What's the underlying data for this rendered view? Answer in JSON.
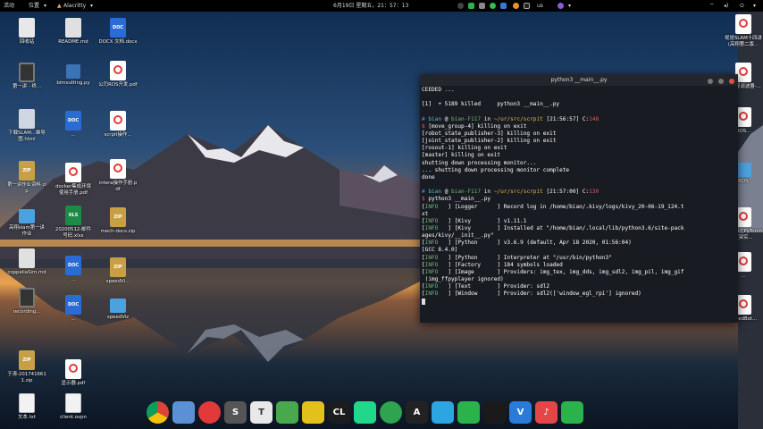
{
  "top_panel": {
    "activities": "活动",
    "places": "位置",
    "app_name": "Alacritty",
    "clock": "6月19日 星期五，21：57：13",
    "tray_text": "us"
  },
  "desktop_icons": [
    {
      "label": "回收站",
      "type": "trash"
    },
    {
      "label": "README.md",
      "type": "md"
    },
    {
      "label": "DOCX 文档.docx",
      "type": "doc"
    },
    {
      "label": "视觉SLAM十四讲(高翔第二版...",
      "type": "pdf"
    },
    {
      "label": "第一讲 - 终...",
      "type": "video"
    },
    {
      "label": "bimsutting.py",
      "type": "py"
    },
    {
      "label": "公司ROS开发.pdf",
      "type": "pdf"
    },
    {
      "label": "卡尔曼滤波器-...",
      "type": "pdf"
    },
    {
      "label": "下载SLAM...维导图.html",
      "type": "html"
    },
    {
      "label": "...",
      "type": "doc"
    },
    {
      "label": "scrpit操作...",
      "type": "pdf"
    },
    {
      "label": "ROS...",
      "type": "pdf"
    },
    {
      "label": "第一讲作业资料.zip",
      "type": "zip"
    },
    {
      "label": "docker集成环境使用手册.pdf",
      "type": "pdf"
    },
    {
      "label": "intera操作手册.pdf",
      "type": "pdf"
    },
    {
      "label": "ROS",
      "type": "folder"
    },
    {
      "label": "高翔slam第一讲作业",
      "type": "folder"
    },
    {
      "label": "20200512-邮件号码.xlsx",
      "type": "xls"
    },
    {
      "label": "mech-docs.zip",
      "type": "zip"
    },
    {
      "label": "强学习之PyTorch框架实...",
      "type": "pdf"
    },
    {
      "label": "coppeliaSim.md",
      "type": "md"
    },
    {
      "label": "...",
      "type": "doc"
    },
    {
      "label": "speedVi...",
      "type": "zip"
    },
    {
      "label": "...",
      "type": "pdf"
    },
    {
      "label": "recording...",
      "type": "video"
    },
    {
      "label": "...",
      "type": "doc"
    },
    {
      "label": "speedViz",
      "type": "folder"
    },
    {
      "label": "speedBot...",
      "type": "pdf"
    },
    {
      "label": "于涛-2017416611.zip",
      "type": "zip"
    },
    {
      "label": "显示器.pdf",
      "type": "pdf"
    },
    {
      "label": "文本.txt",
      "type": "txt"
    },
    {
      "label": "client.ovpn",
      "type": "txt"
    }
  ],
  "terminal": {
    "title": "python3 __main__.py",
    "lines": [
      {
        "segments": [
          [
            "CEEDED ...",
            "white"
          ]
        ]
      },
      {
        "segments": [
          [
            "",
            ""
          ]
        ]
      },
      {
        "segments": [
          [
            "[1]  + 5189 killed     python3 __main__.py",
            "white"
          ]
        ]
      },
      {
        "segments": [
          [
            "",
            ""
          ]
        ]
      },
      {
        "segments": [
          [
            "# ",
            "blue"
          ],
          [
            "bian",
            "cyan"
          ],
          [
            " @ ",
            "white"
          ],
          [
            "bian-F117",
            "green"
          ],
          [
            " in ",
            "white"
          ],
          [
            "~/ur/src/scrpit",
            "yellow"
          ],
          [
            " [21:56:57] ",
            "white"
          ],
          [
            "C:",
            "white"
          ],
          [
            "148",
            "red"
          ]
        ]
      },
      {
        "segments": [
          [
            "$ ",
            "red"
          ],
          [
            "[move_group-4] killing on exit",
            "white"
          ]
        ]
      },
      {
        "segments": [
          [
            "[robot_state_publisher-3] killing on exit",
            "white"
          ]
        ]
      },
      {
        "segments": [
          [
            "[joint_state_publisher-2] killing on exit",
            "white"
          ]
        ]
      },
      {
        "segments": [
          [
            "[rosout-1] killing on exit",
            "white"
          ]
        ]
      },
      {
        "segments": [
          [
            "[master] killing on exit",
            "white"
          ]
        ]
      },
      {
        "segments": [
          [
            "shutting down processing monitor...",
            "white"
          ]
        ]
      },
      {
        "segments": [
          [
            "... shutting down processing monitor complete",
            "white"
          ]
        ]
      },
      {
        "segments": [
          [
            "done",
            "white"
          ]
        ]
      },
      {
        "segments": [
          [
            "",
            ""
          ]
        ]
      },
      {
        "segments": [
          [
            "# ",
            "blue"
          ],
          [
            "bian",
            "cyan"
          ],
          [
            " @ ",
            "white"
          ],
          [
            "bian-F117",
            "green"
          ],
          [
            " in ",
            "white"
          ],
          [
            "~/ur/src/scrpit",
            "yellow"
          ],
          [
            " [21:57:00] ",
            "white"
          ],
          [
            "C:",
            "white"
          ],
          [
            "130",
            "red"
          ]
        ]
      },
      {
        "segments": [
          [
            "$ ",
            "red"
          ],
          [
            "python3 __main__.py",
            "white"
          ]
        ]
      },
      {
        "segments": [
          [
            "[",
            "white"
          ],
          [
            "INFO",
            "green"
          ],
          [
            "   ] [Logger      ] Record log in /home/bian/.kivy/logs/kivy_20-06-19_124.t",
            "white"
          ]
        ]
      },
      {
        "segments": [
          [
            "xt",
            "white"
          ]
        ]
      },
      {
        "segments": [
          [
            "[",
            "white"
          ],
          [
            "INFO",
            "green"
          ],
          [
            "   ] [Kivy        ] v1.11.1",
            "white"
          ]
        ]
      },
      {
        "segments": [
          [
            "[",
            "white"
          ],
          [
            "INFO",
            "green"
          ],
          [
            "   ] [Kivy        ] Installed at \"/home/bian/.local/lib/python3.6/site-pack",
            "white"
          ]
        ]
      },
      {
        "segments": [
          [
            "ages/kivy/__init__.py\"",
            "white"
          ]
        ]
      },
      {
        "segments": [
          [
            "[",
            "white"
          ],
          [
            "INFO",
            "green"
          ],
          [
            "   ] [Python      ] v3.6.9 (default, Apr 18 2020, 01:56:04)",
            "white"
          ]
        ]
      },
      {
        "segments": [
          [
            "[GCC 8.4.0]",
            "white"
          ]
        ]
      },
      {
        "segments": [
          [
            "[",
            "white"
          ],
          [
            "INFO",
            "green"
          ],
          [
            "   ] [Python      ] Interpreter at \"/usr/bin/python3\"",
            "white"
          ]
        ]
      },
      {
        "segments": [
          [
            "[",
            "white"
          ],
          [
            "INFO",
            "green"
          ],
          [
            "   ] [Factory     ] 184 symbols loaded",
            "white"
          ]
        ]
      },
      {
        "segments": [
          [
            "[",
            "white"
          ],
          [
            "INFO",
            "green"
          ],
          [
            "   ] [Image       ] Providers: img_tex, img_dds, img_sdl2, img_pil, img_gif",
            "white"
          ]
        ]
      },
      {
        "segments": [
          [
            " (img_ffpyplayer ignored)",
            "white"
          ]
        ]
      },
      {
        "segments": [
          [
            "[",
            "white"
          ],
          [
            "INFO",
            "green"
          ],
          [
            "   ] [Text        ] Provider: sdl2",
            "white"
          ]
        ]
      },
      {
        "segments": [
          [
            "[",
            "white"
          ],
          [
            "INFO",
            "green"
          ],
          [
            "   ] [Window      ] Provider: sdl2(['window_egl_rpi'] ignored)",
            "white"
          ]
        ]
      }
    ]
  },
  "dock": [
    {
      "icon": "chrome-icon",
      "color": "#dd4b39",
      "glyph": ""
    },
    {
      "icon": "file-manager-icon",
      "color": "#5b8fd6",
      "glyph": ""
    },
    {
      "icon": "netease-music-icon",
      "color": "#e23a3a",
      "glyph": ""
    },
    {
      "icon": "s-app-icon",
      "color": "#555555",
      "glyph": "S"
    },
    {
      "icon": "typora-icon",
      "color": "#e8e8e8",
      "glyph": "T"
    },
    {
      "icon": "puzzle-app-icon",
      "color": "#49a84b",
      "glyph": ""
    },
    {
      "icon": "colorful-app-icon",
      "color": "#e3c11a",
      "glyph": ""
    },
    {
      "icon": "clion-icon",
      "color": "#1c1c1c",
      "glyph": "CL"
    },
    {
      "icon": "pycharm-icon",
      "color": "#21d789",
      "glyph": ""
    },
    {
      "icon": "loading-ring-icon",
      "color": "#2ea44f",
      "glyph": ""
    },
    {
      "icon": "alacritty-icon",
      "color": "#222222",
      "glyph": "A"
    },
    {
      "icon": "telegram-icon",
      "color": "#2ca5e0",
      "glyph": ""
    },
    {
      "icon": "wechat-icon",
      "color": "#29b34a",
      "glyph": ""
    },
    {
      "icon": "qq-icon",
      "color": "#1a1a1a",
      "glyph": ""
    },
    {
      "icon": "vscode-icon",
      "color": "#2a7bd8",
      "glyph": "V"
    },
    {
      "icon": "music-icon",
      "color": "#e64545",
      "glyph": "♪"
    },
    {
      "icon": "wechat-2-icon",
      "color": "#29b34a",
      "glyph": ""
    }
  ]
}
